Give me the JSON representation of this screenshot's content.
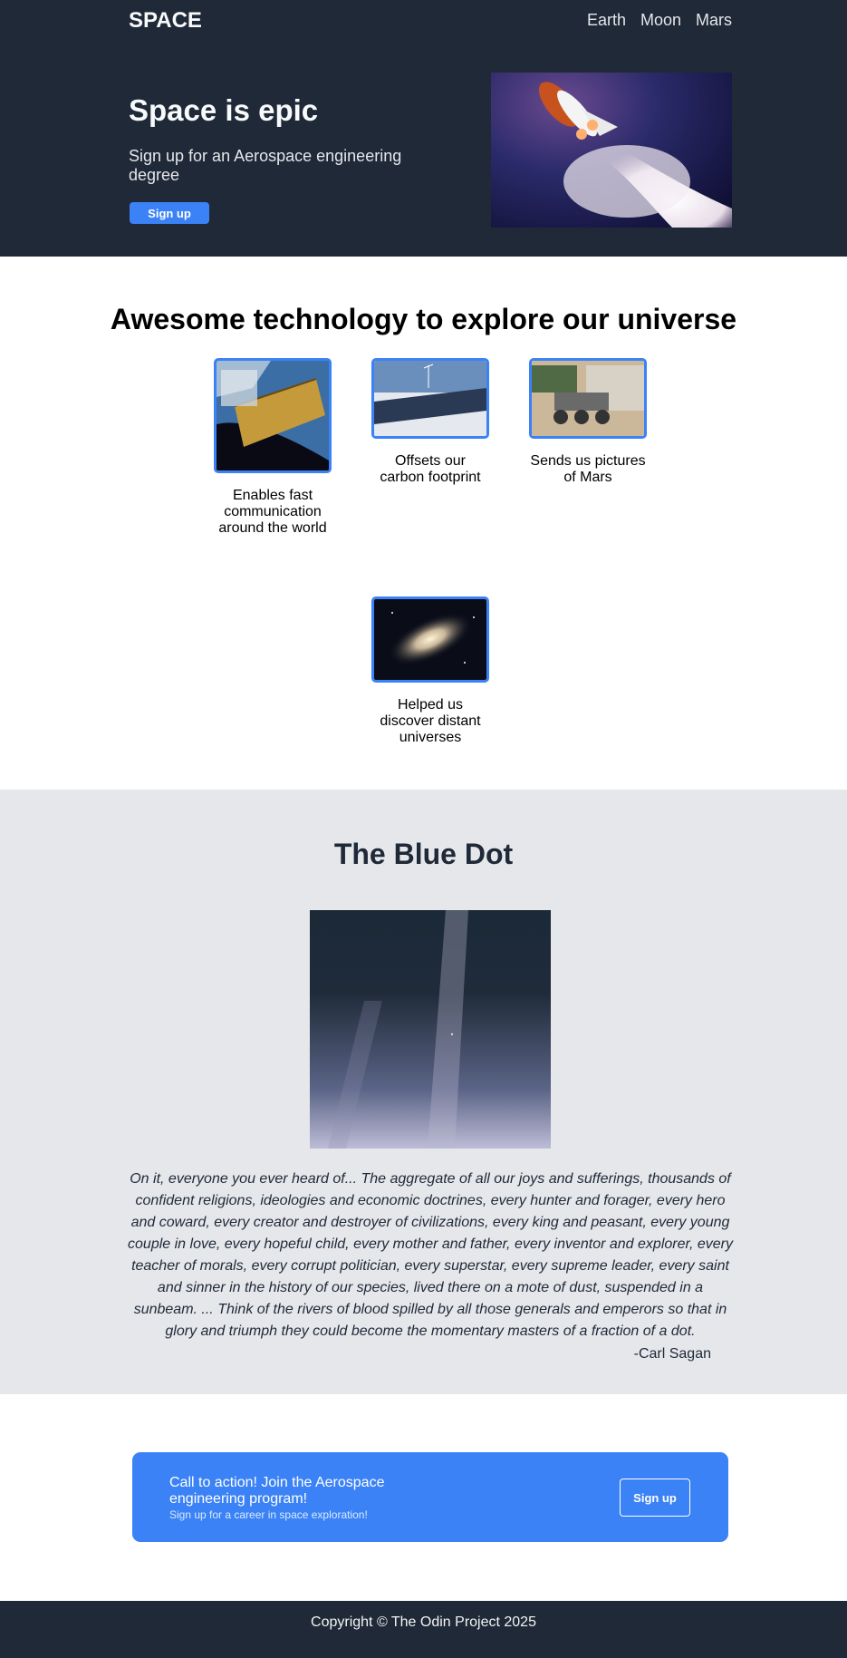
{
  "header": {
    "logo": "SPACE",
    "nav": [
      "Earth",
      "Moon",
      "Mars"
    ]
  },
  "hero": {
    "title": "Space is epic",
    "subtitle": "Sign up for an Aerospace engineering degree",
    "button_label": "Sign up"
  },
  "tech": {
    "title": "Awesome technology to explore our universe",
    "items": [
      {
        "caption": "Enables fast communication around the world"
      },
      {
        "caption": "Offsets our carbon footprint"
      },
      {
        "caption": "Sends us pictures of Mars"
      },
      {
        "caption": "Helped us discover distant universes"
      }
    ]
  },
  "blue_dot": {
    "title": "The Blue Dot",
    "quote": "On it, everyone you ever heard of... The aggregate of all our joys and sufferings, thousands of confident religions, ideologies and economic doctrines, every hunter and forager, every hero and coward, every creator and destroyer of civilizations, every king and peasant, every young couple in love, every hopeful child, every mother and father, every inventor and explorer, every teacher of morals, every corrupt politician, every superstar, every supreme leader, every saint and sinner in the history of our species, lived there on a mote of dust, suspended in a sunbeam. ... Think of the rivers of blood spilled by all those generals and emperors so that in glory and triumph they could become the momentary masters of a fraction of a dot.",
    "author": "-Carl Sagan"
  },
  "cta": {
    "title": "Call to action! Join the Aerospace engineering program!",
    "subtitle": "Sign up for a career in space exploration!",
    "button_label": "Sign up"
  },
  "footer": {
    "copyright": "Copyright © The Odin Project 2025"
  },
  "colors": {
    "dark": "#1f2937",
    "accent": "#3b82f6",
    "section_bg": "#e5e7eb"
  }
}
